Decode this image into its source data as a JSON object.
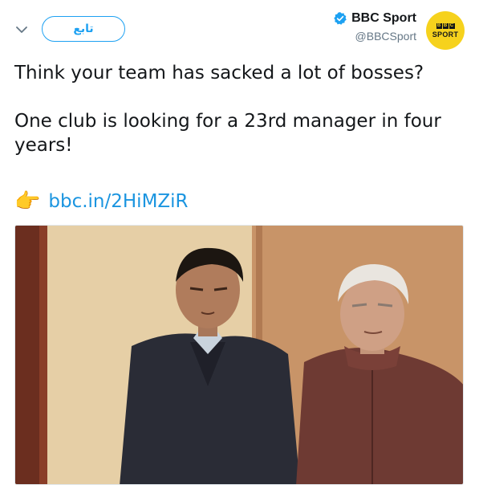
{
  "header": {
    "follow_label": "تابع",
    "display_name": "BBC Sport",
    "handle": "@BBCSport",
    "avatar_letters": [
      "B",
      "B",
      "C"
    ],
    "avatar_word": "SPORT",
    "icons": {
      "chevron": "chevron-down-icon",
      "verified": "verified-badge-icon"
    }
  },
  "tweet": {
    "line1": "Think your team has sacked a lot of bosses?",
    "line2": "One club is looking for a 23rd manager in four years!",
    "emoji": "👉",
    "link": "bbc.in/2HiMZiR"
  },
  "colors": {
    "accent": "#1da1f2",
    "link": "#1b95e0",
    "avatar_bg": "#f6d21d",
    "verified": "#1da1f2"
  }
}
